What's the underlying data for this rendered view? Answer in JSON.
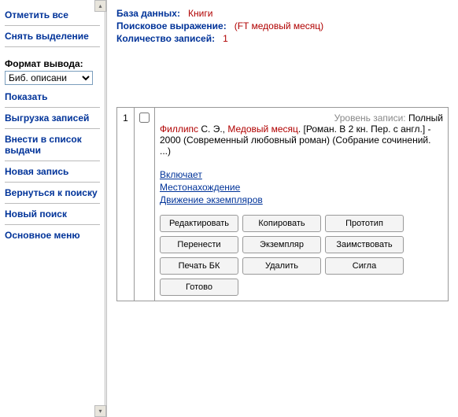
{
  "sidebar": {
    "mark_all": "Отметить все",
    "clear_sel": "Снять выделение",
    "format_label": "Формат вывода:",
    "format_value": "Биб. описани",
    "show": "Показать",
    "export": "Выгрузка записей",
    "add_to_list": "Внести в список выдачи",
    "new_record": "Новая запись",
    "back_to_search": "Вернуться к поиску",
    "new_search": "Новый поиск",
    "main_menu": "Основное меню"
  },
  "header": {
    "db_label": "База данных:",
    "db_value": "Книги",
    "expr_label": "Поисковое выражение:",
    "expr_value": "(FT медовый месяц)",
    "count_label": "Количество записей:",
    "count_value": "1"
  },
  "record": {
    "num": "1",
    "level_label": "Уровень записи:",
    "level_value": "Полный",
    "author": "Филлипс",
    "author_rest": " С. Э., ",
    "title": "Медовый месяц",
    "desc": ". [Роман. В 2 кн. Пер. с англ.] - 2000 (Современный любовный роман) (Собрание сочинений. ...)",
    "links": {
      "includes": "Включает",
      "location": "Местонахождение",
      "movement": "Движение экземпляров"
    },
    "buttons": {
      "edit": "Редактировать",
      "copy": "Копировать",
      "proto": "Прототип",
      "move": "Перенести",
      "instance": "Экземпляр",
      "borrow": "Заимствовать",
      "print": "Печать БК",
      "delete": "Удалить",
      "sigla": "Сигла",
      "done": "Готово"
    }
  }
}
